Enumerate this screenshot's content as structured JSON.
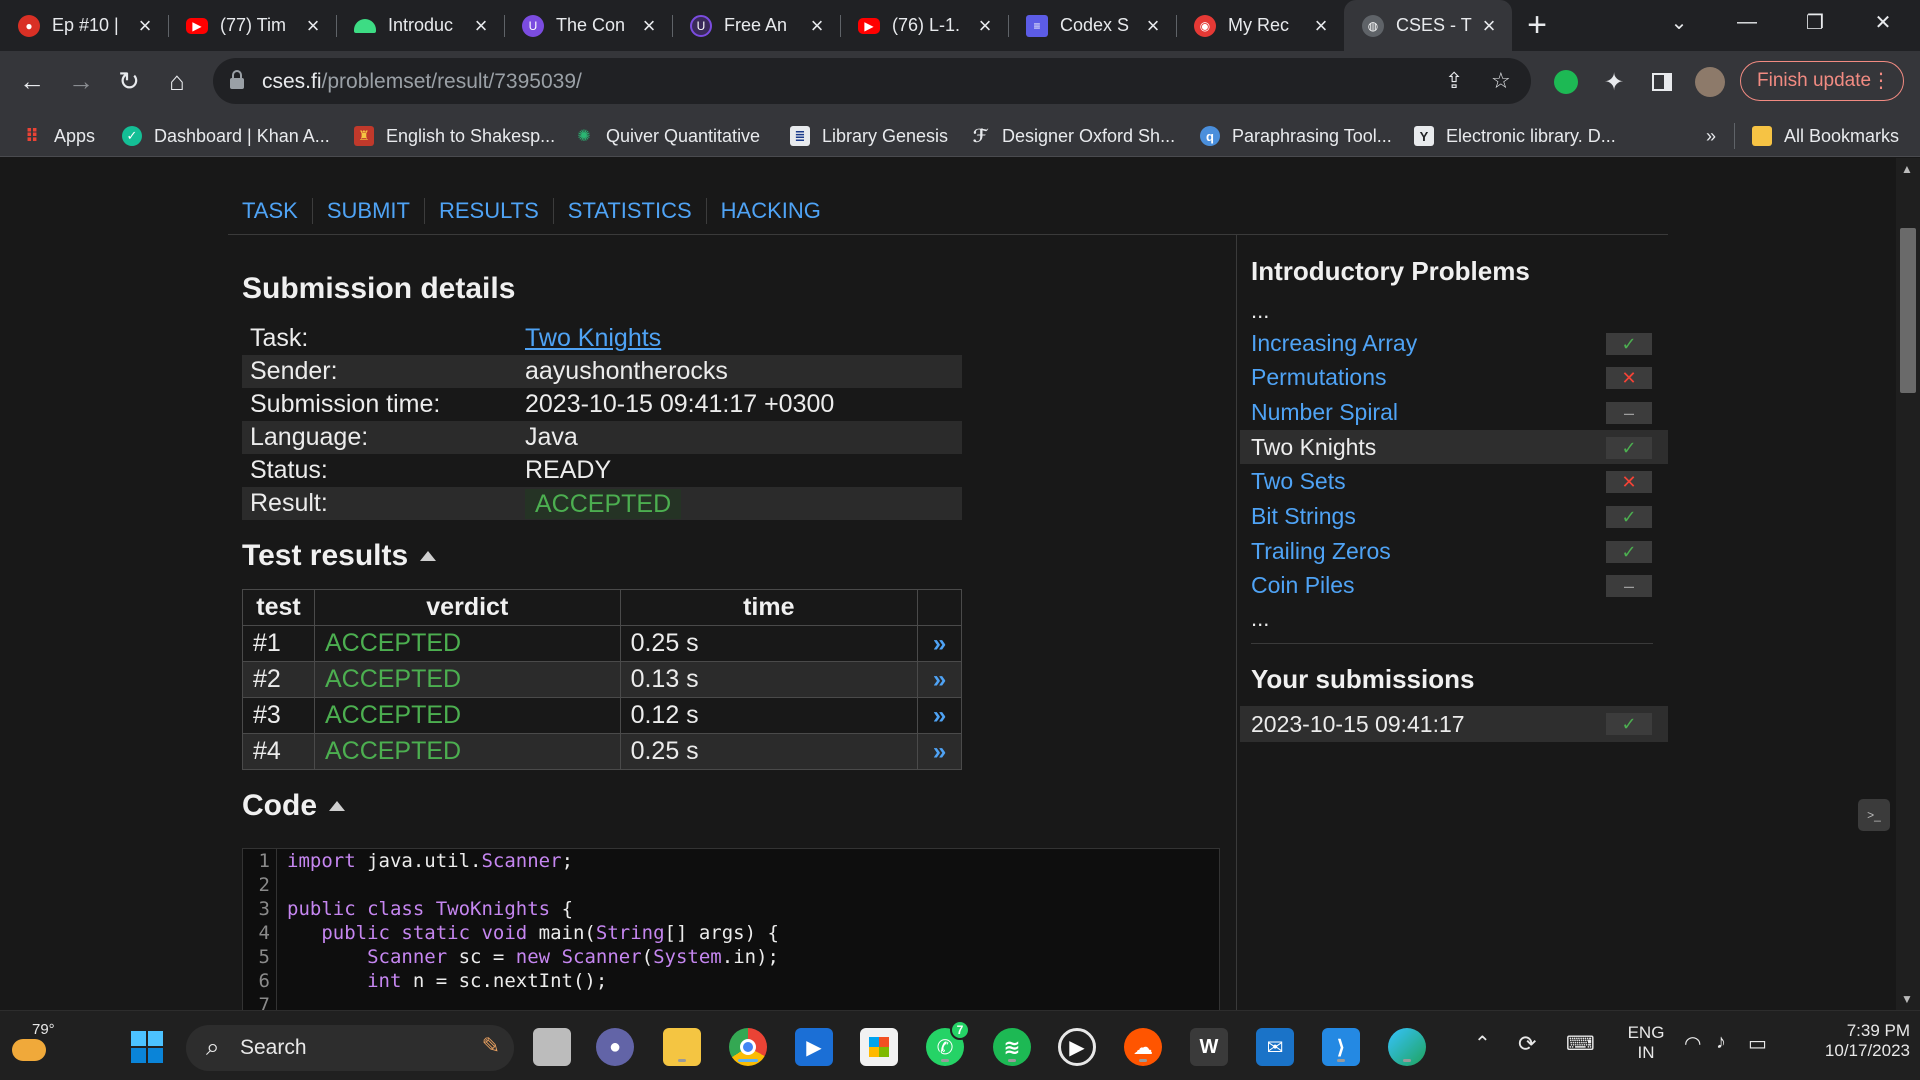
{
  "browser": {
    "tabs": [
      {
        "title": "Ep #10 |",
        "icon": "recording-icon",
        "color": "#d93025"
      },
      {
        "title": "(77) Tim",
        "icon": "youtube-icon",
        "color": "#ff0000"
      },
      {
        "title": "Introduc",
        "icon": "android-icon",
        "color": "#3ddc84"
      },
      {
        "title": "The Con",
        "icon": "u-icon",
        "color": "#7b4ce0"
      },
      {
        "title": "Free An",
        "icon": "circle-u-icon",
        "color": "#7b4ce0"
      },
      {
        "title": "(76) L-1.",
        "icon": "youtube-icon",
        "color": "#ff0000"
      },
      {
        "title": "Codex S",
        "icon": "codex-icon",
        "color": "#5c5ce6"
      },
      {
        "title": "My Rec",
        "icon": "pocketcasts-icon",
        "color": "#e53935"
      },
      {
        "title": "CSES - T",
        "icon": "globe-icon",
        "color": "#9aa0a6",
        "active": true
      }
    ],
    "address": {
      "domain": "cses.fi",
      "path": "/problemset/result/7395039/"
    },
    "update_label": "Finish update",
    "bookmarks": [
      {
        "label": "Apps",
        "icon": "apps-grid-icon"
      },
      {
        "label": "Dashboard | Khan A...",
        "icon": "khan-academy-icon"
      },
      {
        "label": "English to Shakesp...",
        "icon": "shakespeare-icon"
      },
      {
        "label": "Quiver Quantitative",
        "icon": "quiver-icon"
      },
      {
        "label": "Library Genesis",
        "icon": "book-icon"
      },
      {
        "label": "Designer Oxford Sh...",
        "icon": "designer-icon"
      },
      {
        "label": "Paraphrasing Tool...",
        "icon": "quillbot-icon"
      },
      {
        "label": "Electronic library. D...",
        "icon": "zlib-icon"
      },
      {
        "label": "All Bookmarks",
        "icon": "folder-icon"
      }
    ],
    "bookmarks_overflow": "»"
  },
  "page": {
    "menu": [
      "TASK",
      "SUBMIT",
      "RESULTS",
      "STATISTICS",
      "HACKING"
    ],
    "submission": {
      "heading": "Submission details",
      "rows": [
        {
          "key": "Task:",
          "value": "Two Knights"
        },
        {
          "key": "Sender:",
          "value": "aayushontherocks"
        },
        {
          "key": "Submission time:",
          "value": "2023-10-15 09:41:17 +0300"
        },
        {
          "key": "Language:",
          "value": "Java"
        },
        {
          "key": "Status:",
          "value": "READY"
        },
        {
          "key": "Result:",
          "value": "ACCEPTED"
        }
      ]
    },
    "tests": {
      "heading": "Test results",
      "columns": [
        "test",
        "verdict",
        "time",
        ""
      ],
      "rows": [
        {
          "test": "#1",
          "verdict": "ACCEPTED",
          "time": "0.25 s"
        },
        {
          "test": "#2",
          "verdict": "ACCEPTED",
          "time": "0.13 s"
        },
        {
          "test": "#3",
          "verdict": "ACCEPTED",
          "time": "0.12 s"
        },
        {
          "test": "#4",
          "verdict": "ACCEPTED",
          "time": "0.25 s"
        }
      ],
      "view_label": "»"
    },
    "code": {
      "heading": "Code",
      "line_numbers": [
        "1",
        "2",
        "3",
        "4",
        "5",
        "6",
        "7"
      ]
    },
    "sidebar": {
      "title": "Introductory Problems",
      "ellipsis": "...",
      "problems": [
        {
          "name": "Increasing Array",
          "status": "ok"
        },
        {
          "name": "Permutations",
          "status": "bad"
        },
        {
          "name": "Number Spiral",
          "status": "none"
        },
        {
          "name": "Two Knights",
          "status": "ok",
          "current": true
        },
        {
          "name": "Two Sets",
          "status": "bad"
        },
        {
          "name": "Bit Strings",
          "status": "ok"
        },
        {
          "name": "Trailing Zeros",
          "status": "ok"
        },
        {
          "name": "Coin Piles",
          "status": "none"
        }
      ],
      "submissions_title": "Your submissions",
      "submissions": [
        {
          "time": "2023-10-15 09:41:17",
          "status": "ok"
        }
      ]
    }
  },
  "taskbar": {
    "weather": "79°",
    "search_placeholder": "Search",
    "whatsapp_badge": "7",
    "lang_top": "ENG",
    "lang_bottom": "IN",
    "time": "7:39 PM",
    "date": "10/17/2023"
  },
  "colors": {
    "accent": "#4fa3f5",
    "accepted": "#4caf50",
    "rejected": "#f44336"
  }
}
